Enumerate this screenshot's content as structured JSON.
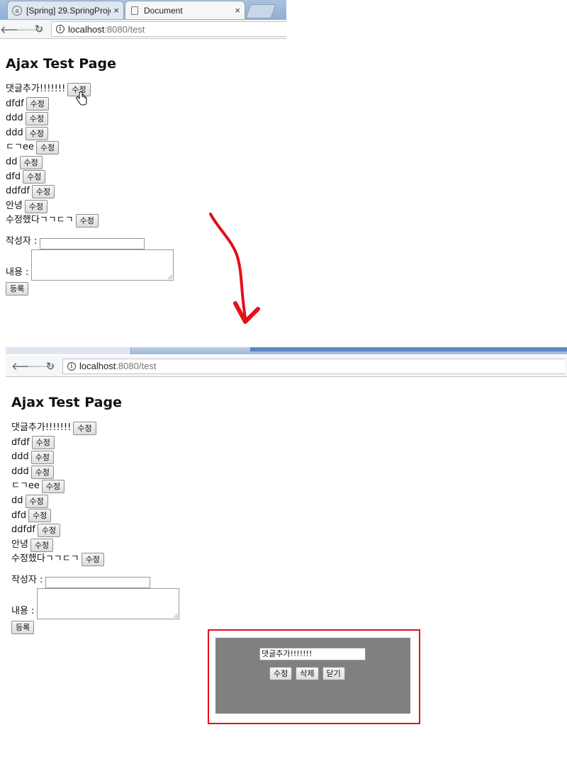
{
  "browser1": {
    "tabs": [
      {
        "title": "[Spring] 29.SpringProject",
        "close": "×"
      },
      {
        "title": "Document",
        "close": "×"
      }
    ],
    "url_host": "localhost",
    "url_path": ":8080/test"
  },
  "browser2": {
    "url_host": "localhost",
    "url_path": ":8080/test"
  },
  "page": {
    "title": "Ajax Test Page",
    "edit_label": "수정",
    "replies": [
      "댓글추가!!!!!!!",
      "dfdf",
      "ddd",
      "ddd",
      "ㄷㄱee",
      "dd",
      "dfd",
      "ddfdf",
      "안녕",
      "수정했다ㄱㄱㄷㄱ"
    ],
    "writer_label": "작성자 :",
    "content_label": "내용 :",
    "submit_label": "등록"
  },
  "modal": {
    "input_value": "댓글추가!!!!!!!",
    "edit_label": "수정",
    "delete_label": "삭제",
    "close_label": "닫기"
  },
  "colors": {
    "arrow": "#e3101a",
    "highlight": "#e3101a",
    "modal_bg": "#808080"
  }
}
